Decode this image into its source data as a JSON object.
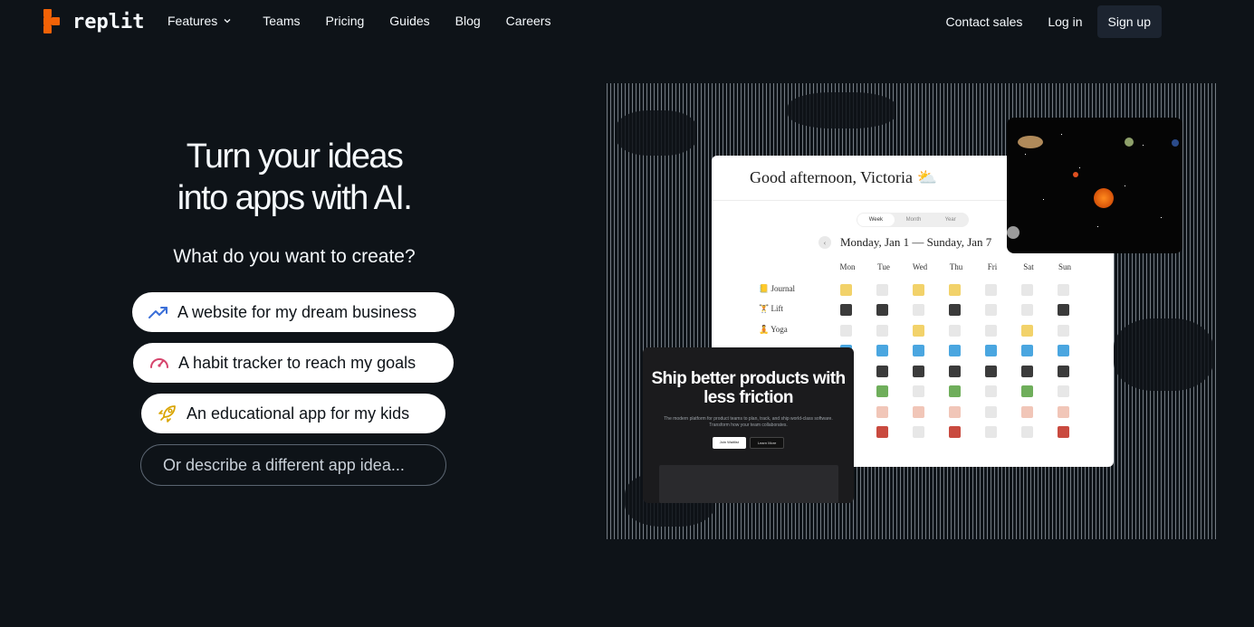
{
  "nav": {
    "brand": "replit",
    "links": [
      "Features",
      "Teams",
      "Pricing",
      "Guides",
      "Blog",
      "Careers"
    ],
    "contact": "Contact sales",
    "login": "Log in",
    "signup": "Sign up"
  },
  "hero": {
    "title_line1": "Turn your ideas",
    "title_line2": "into apps with AI.",
    "subtitle": "What do you want to create?",
    "suggestions": [
      {
        "label": "A website for my dream business",
        "icon": "trend-up-icon",
        "color": "#3b6fd8"
      },
      {
        "label": "A habit tracker to reach my goals",
        "icon": "gauge-icon",
        "color": "#d6456d"
      },
      {
        "label": "An educational app for my kids",
        "icon": "rocket-icon",
        "color": "#d9a400"
      }
    ],
    "custom_prompt": "Or describe a different app idea..."
  },
  "preview": {
    "greeting": "Good afternoon, Victoria ⛅",
    "segments": [
      "Week",
      "Month",
      "Year"
    ],
    "range": "Monday, Jan 1 — Sunday, Jan 7",
    "days": [
      "Mon",
      "Tue",
      "Wed",
      "Thu",
      "Fri",
      "Sat",
      "Sun"
    ],
    "habits": [
      "📒 Journal",
      "🏋 Lift",
      "🧘 Yoga"
    ],
    "product_title": "Ship better products with less friction",
    "product_desc": "The modern platform for product teams to plan, track, and ship world-class software. Transform how your team collaborates.",
    "product_btn1": "Join Waitlist",
    "product_btn2": "Learn More"
  },
  "colors": {
    "background": "#0e1318",
    "brand": "#f26207",
    "signup_bg": "#1c2430"
  }
}
